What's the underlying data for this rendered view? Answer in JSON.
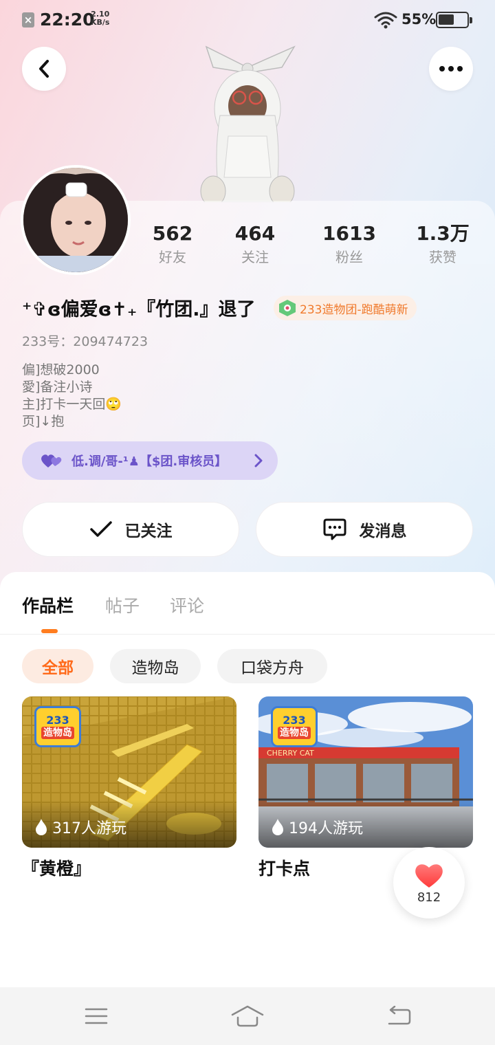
{
  "status_bar": {
    "time": "22:20",
    "net_speed_value": "2.10",
    "net_speed_unit": "KB/s",
    "battery": "55%",
    "battery_level": 0.55
  },
  "profile": {
    "stats": [
      {
        "value": "562",
        "label": "好友"
      },
      {
        "value": "464",
        "label": "关注"
      },
      {
        "value": "1613",
        "label": "粉丝"
      },
      {
        "value": "1.3万",
        "label": "获赞"
      }
    ],
    "nickname": "⁺✞ɞ偏爱ɞ✝₊『竹团.』退了",
    "team_badge": "233造物团-跑酷萌新",
    "uid": "233号：209474723",
    "bio": [
      "偏]想破2000",
      "愛]备注小诗",
      "主]打卡一天回🙄",
      "页]↓抱"
    ],
    "guild": "低.调/哥-¹♟【$团.审核员】",
    "follow_button": "已关注",
    "message_button": "发消息"
  },
  "tabs": [
    {
      "label": "作品栏",
      "active": true
    },
    {
      "label": "帖子",
      "active": false
    },
    {
      "label": "评论",
      "active": false
    }
  ],
  "filters": [
    {
      "label": "全部",
      "active": true
    },
    {
      "label": "造物岛",
      "active": false
    },
    {
      "label": "口袋方舟",
      "active": false
    }
  ],
  "works": [
    {
      "title": "『黄橙』",
      "plays": "317人游玩",
      "logo_line1": "233",
      "logo_line2": "造物岛"
    },
    {
      "title": "打卡点",
      "plays": "194人游玩",
      "logo_line1": "233",
      "logo_line2": "造物岛",
      "sign_text": "CHERRY CAT"
    }
  ],
  "like": {
    "count": "812"
  },
  "colors": {
    "accent": "#ff7d1f",
    "guild_text": "#6b54c9",
    "badge_text": "#f07a2c",
    "heart": "#ff4a4a"
  }
}
